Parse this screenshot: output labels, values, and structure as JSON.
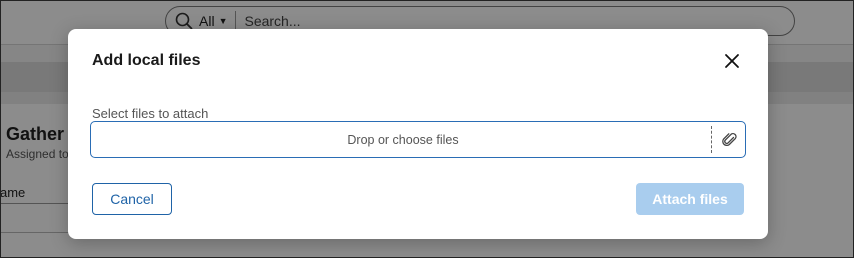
{
  "background": {
    "search": {
      "scope": "All",
      "placeholder": "Search..."
    },
    "task_title": "Gather c",
    "task_sub": "Assigned to",
    "column_header": "ame"
  },
  "dialog": {
    "title": "Add local files",
    "field_label": "Select files to attach",
    "dropzone_text": "Drop or choose files",
    "cancel_label": "Cancel",
    "attach_label": "Attach files",
    "attach_disabled": true
  },
  "colors": {
    "primary": "#1f63a7",
    "dropzone_border": "#2a6db5",
    "attach_disabled_bg": "#a9cdee"
  }
}
